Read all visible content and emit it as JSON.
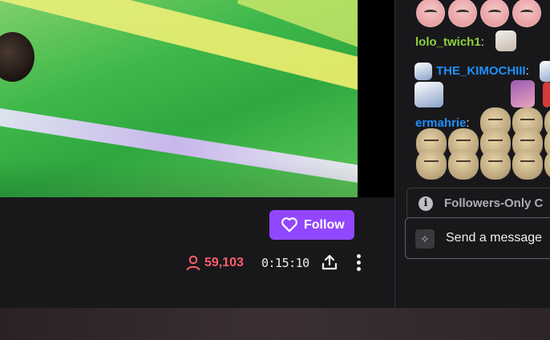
{
  "video": {
    "description_icon": "video-frame"
  },
  "chat": {
    "messages": [
      {
        "user": "lolo_twich1",
        "color": "#8fd13b",
        "colon": ":"
      },
      {
        "user": "THE_KIMOCHIII",
        "color": "#1e90ff",
        "colon": ":"
      },
      {
        "user": "ermahrie",
        "color": "#1e90ff",
        "colon": ":"
      }
    ],
    "followers_only_text": "Followers-Only C",
    "info_icon_glyph": "i",
    "send_placeholder": "Send a message",
    "spark_icon_glyph": "✧"
  },
  "channel": {
    "follow_label": "Follow",
    "viewer_count": "59,103",
    "uptime": "0:15:10"
  },
  "colors": {
    "accent": "#9147ff",
    "viewer_red": "#ff5d6c",
    "lime_name": "#8fd13b",
    "blue_name": "#1e90ff"
  }
}
